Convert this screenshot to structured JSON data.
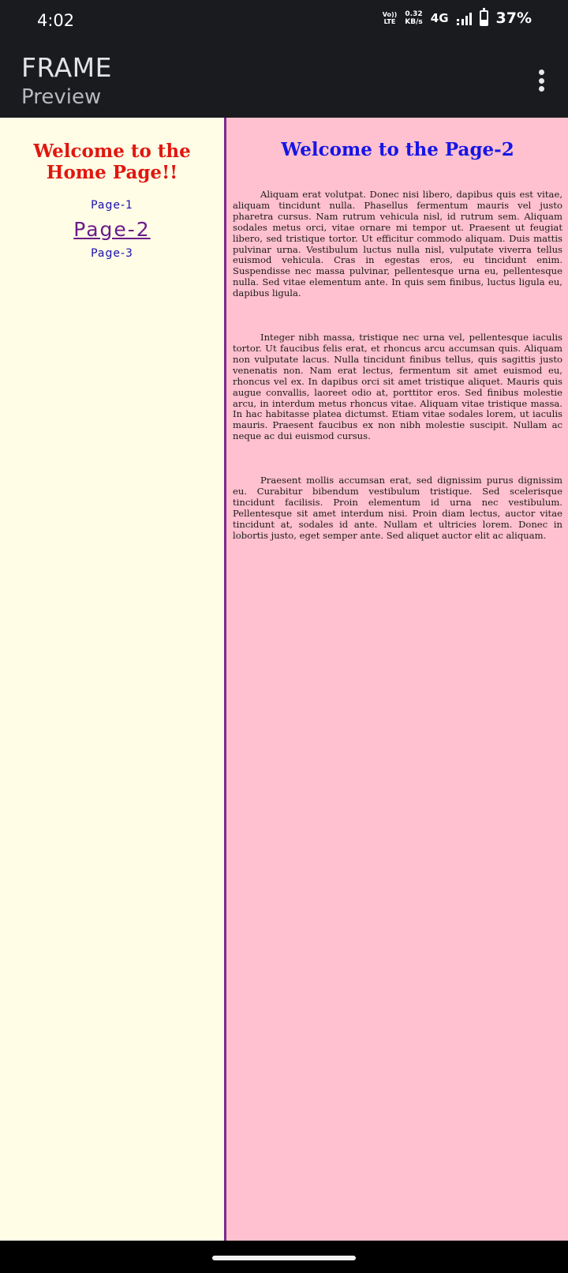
{
  "status_bar": {
    "time": "4:02",
    "volte_top": "Vo))",
    "volte_bottom": "LTE",
    "speed_value": "0.32",
    "speed_unit": "KB/s",
    "network": "4G",
    "battery_percent": "37%",
    "battery_level": 0.37
  },
  "app_bar": {
    "title": "FRAME",
    "subtitle": "Preview",
    "menu_icon": "more-vert-icon"
  },
  "left_frame": {
    "heading": "Welcome to the Home Page!!",
    "links": [
      {
        "label": "Page-1",
        "active": false
      },
      {
        "label": "Page-2",
        "active": true
      },
      {
        "label": "Page-3",
        "active": false
      }
    ],
    "background": "#fffde6",
    "heading_color": "#e0170f"
  },
  "right_frame": {
    "heading": "Welcome to the Page-2",
    "paragraphs": [
      "Aliquam erat volutpat. Donec nisi libero, dapibus quis est vitae, aliquam tincidunt nulla. Phasellus fermentum mauris vel justo pharetra cursus. Nam rutrum vehicula nisl, id rutrum sem. Aliquam sodales metus orci, vitae ornare mi tempor ut. Praesent ut feugiat libero, sed tristique tortor. Ut efficitur commodo aliquam. Duis mattis pulvinar urna. Vestibulum luctus nulla nisl, vulputate viverra tellus euismod vehicula. Cras in egestas eros, eu tincidunt enim. Suspendisse nec massa pulvinar, pellentesque urna eu, pellentesque nulla. Sed vitae elementum ante. In quis sem finibus, luctus ligula eu, dapibus ligula.",
      "Integer nibh massa, tristique nec urna vel, pellentesque iaculis tortor. Ut faucibus felis erat, et rhoncus arcu accumsan quis. Aliquam non vulputate lacus. Nulla tincidunt finibus tellus, quis sagittis justo venenatis non. Nam erat lectus, fermentum sit amet euismod eu, rhoncus vel ex. In dapibus orci sit amet tristique aliquet. Mauris quis augue convallis, laoreet odio at, porttitor eros. Sed finibus molestie arcu, in interdum metus rhoncus vitae. Aliquam vitae tristique massa. In hac habitasse platea dictumst. Etiam vitae sodales lorem, ut iaculis mauris. Praesent faucibus ex non nibh molestie suscipit. Nullam ac neque ac dui euismod cursus.",
      "Praesent mollis accumsan erat, sed dignissim purus dignissim eu. Curabitur bibendum vestibulum tristique. Sed scelerisque tincidunt facilisis. Proin elementum id urna nec vestibulum. Pellentesque sit amet interdum nisi. Proin diam lectus, auctor vitae tincidunt at, sodales id ante. Nullam et ultricies lorem. Donec in lobortis justo, eget semper ante. Sed aliquet auctor elit ac aliquam."
    ],
    "background": "#ffc0cf",
    "heading_color": "#1515e6"
  },
  "colors": {
    "divider": "#7b2a8c",
    "link": "#1a0dab",
    "visited_link": "#6a1b8a",
    "system_bar": "#1a1b1f"
  }
}
